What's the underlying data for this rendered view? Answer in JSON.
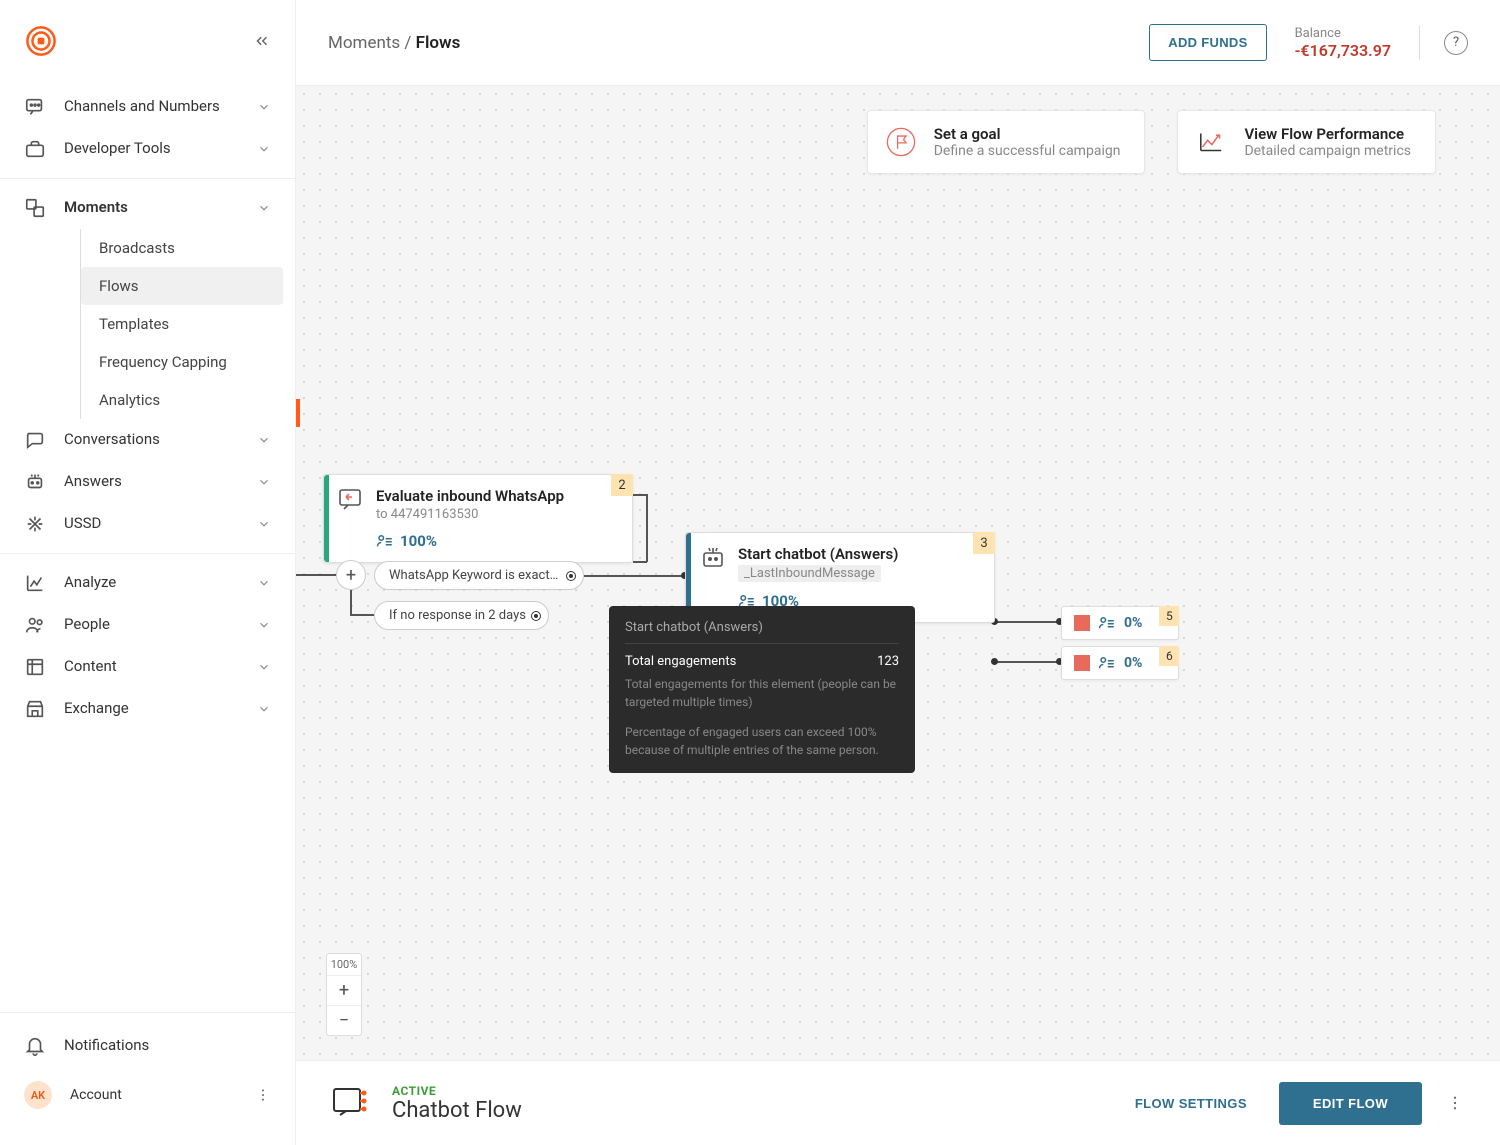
{
  "breadcrumb": {
    "parent": "Moments",
    "sep": " / ",
    "current": "Flows"
  },
  "topbar": {
    "add_funds": "ADD FUNDS",
    "balance_label": "Balance",
    "balance_value": "-€167,733.97"
  },
  "sidebar": {
    "channels": "Channels and Numbers",
    "developer": "Developer Tools",
    "moments": "Moments",
    "moments_sub": {
      "broadcasts": "Broadcasts",
      "flows": "Flows",
      "templates": "Templates",
      "frequency": "Frequency Capping",
      "analytics": "Analytics"
    },
    "conversations": "Conversations",
    "answers": "Answers",
    "ussd": "USSD",
    "analyze": "Analyze",
    "people": "People",
    "content": "Content",
    "exchange": "Exchange",
    "notifications": "Notifications",
    "account": "Account",
    "account_initials": "AK"
  },
  "info_cards": {
    "goal_title": "Set a goal",
    "goal_sub": "Define a successful campaign",
    "perf_title": "View Flow Performance",
    "perf_sub": "Detailed campaign metrics"
  },
  "nodes": {
    "n1": {
      "badge": "2",
      "title": "Evaluate inbound WhatsApp",
      "sub": "to 447491163530",
      "metric": "100%"
    },
    "n2": {
      "badge": "3",
      "title": "Start chatbot (Answers)",
      "sub": "_LastInboundMessage",
      "metric": "100%"
    },
    "mini1": {
      "badge": "5",
      "pct": "0%"
    },
    "mini2": {
      "badge": "6",
      "pct": "0%"
    }
  },
  "branches": {
    "b1": "WhatsApp Keyword is exact ma...",
    "b2": "If no response in 2 days"
  },
  "tooltip": {
    "title": "Start chatbot (Answers)",
    "row_label": "Total engagements",
    "row_value": "123",
    "desc": "Total engagements for this element (people can be targeted multiple times)",
    "note": "Percentage of engaged users can exceed 100% because of multiple entries of the same person."
  },
  "zoom": {
    "level": "100%"
  },
  "bottombar": {
    "status": "ACTIVE",
    "name": "Chatbot Flow",
    "flow_settings": "FLOW SETTINGS",
    "edit_flow": "EDIT FLOW"
  }
}
